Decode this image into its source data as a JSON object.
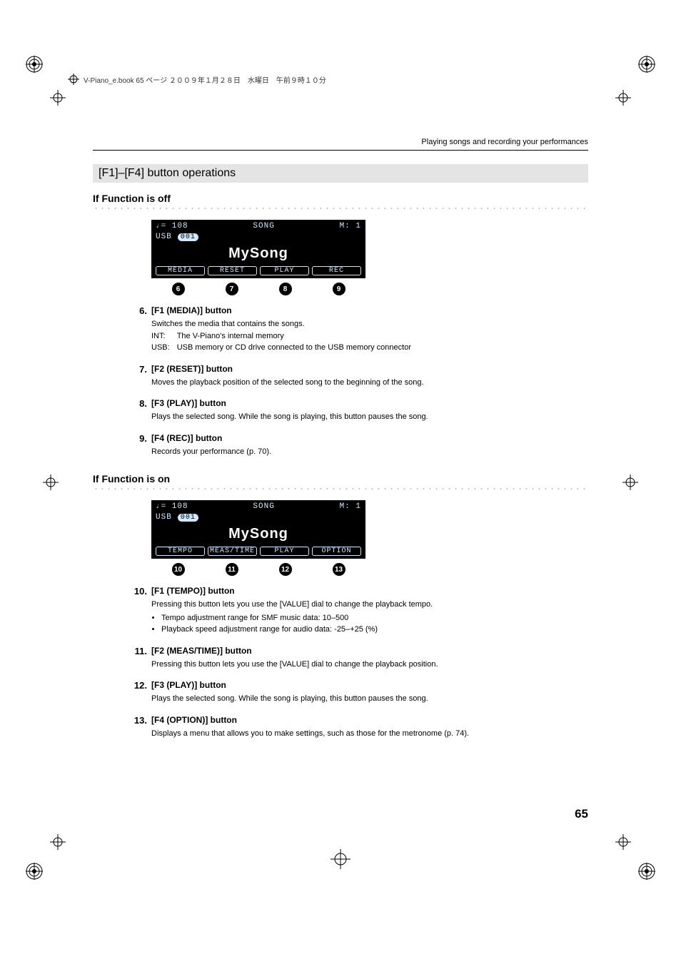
{
  "header": {
    "bookline": "V-Piano_e.book 65 ページ ２００９年１月２８日　水曜日　午前９時１０分",
    "section_title": "Playing songs and recording your performances"
  },
  "bar": "[F1]–[F4] button operations",
  "off": {
    "heading": "If Function is off",
    "lcd": {
      "tempo": "♩= 108",
      "title_top": "SONG",
      "measure": "M:   1",
      "source": "USB",
      "num": "001",
      "song": "MySong",
      "f1": "MEDIA",
      "f2": "RESET",
      "f3": "PLAY",
      "f4": "REC"
    },
    "callouts": [
      "6",
      "7",
      "8",
      "9"
    ],
    "items": [
      {
        "n": "6.",
        "t": "[F1 (MEDIA)] button",
        "lines": [
          "Switches the media that contains the songs."
        ],
        "table": [
          [
            "INT:",
            "The V-Piano's internal memory"
          ],
          [
            "USB:",
            "USB memory or CD drive connected to the USB memory connector"
          ]
        ]
      },
      {
        "n": "7.",
        "t": "[F2 (RESET)] button",
        "lines": [
          "Moves the playback position of the selected song to the beginning of the song."
        ]
      },
      {
        "n": "8.",
        "t": "[F3 (PLAY)] button",
        "lines": [
          "Plays the selected song. While the song is playing, this button pauses the song."
        ]
      },
      {
        "n": "9.",
        "t": "[F4 (REC)] button",
        "lines": [
          "Records your performance (p. 70)."
        ]
      }
    ]
  },
  "on": {
    "heading": "If Function is on",
    "lcd": {
      "tempo": "♩= 108",
      "title_top": "SONG",
      "measure": "M:   1",
      "source": "USB",
      "num": "001",
      "song": "MySong",
      "f1": "TEMPO",
      "f2": "MEAS/TIME",
      "f3": "PLAY",
      "f4": "OPTION"
    },
    "callouts": [
      "10",
      "11",
      "12",
      "13"
    ],
    "items": [
      {
        "n": "10.",
        "t": "[F1 (TEMPO)] button",
        "lines": [
          "Pressing this button lets you use the [VALUE] dial to change the playback tempo."
        ],
        "bullets": [
          "Tempo adjustment range for SMF music data: 10–500",
          "Playback speed adjustment range for audio data: -25–+25 (%)"
        ]
      },
      {
        "n": "11.",
        "t": "[F2 (MEAS/TIME)] button",
        "lines": [
          "Pressing this button lets you use the [VALUE] dial to change the playback position."
        ]
      },
      {
        "n": "12.",
        "t": "[F3 (PLAY)] button",
        "lines": [
          "Plays the selected song. While the song is playing, this button pauses the song."
        ]
      },
      {
        "n": "13.",
        "t": "[F4 (OPTION)] button",
        "lines": [
          "Displays a menu that allows you to make settings, such as those for the metronome (p. 74)."
        ]
      }
    ]
  },
  "page_number": "65"
}
